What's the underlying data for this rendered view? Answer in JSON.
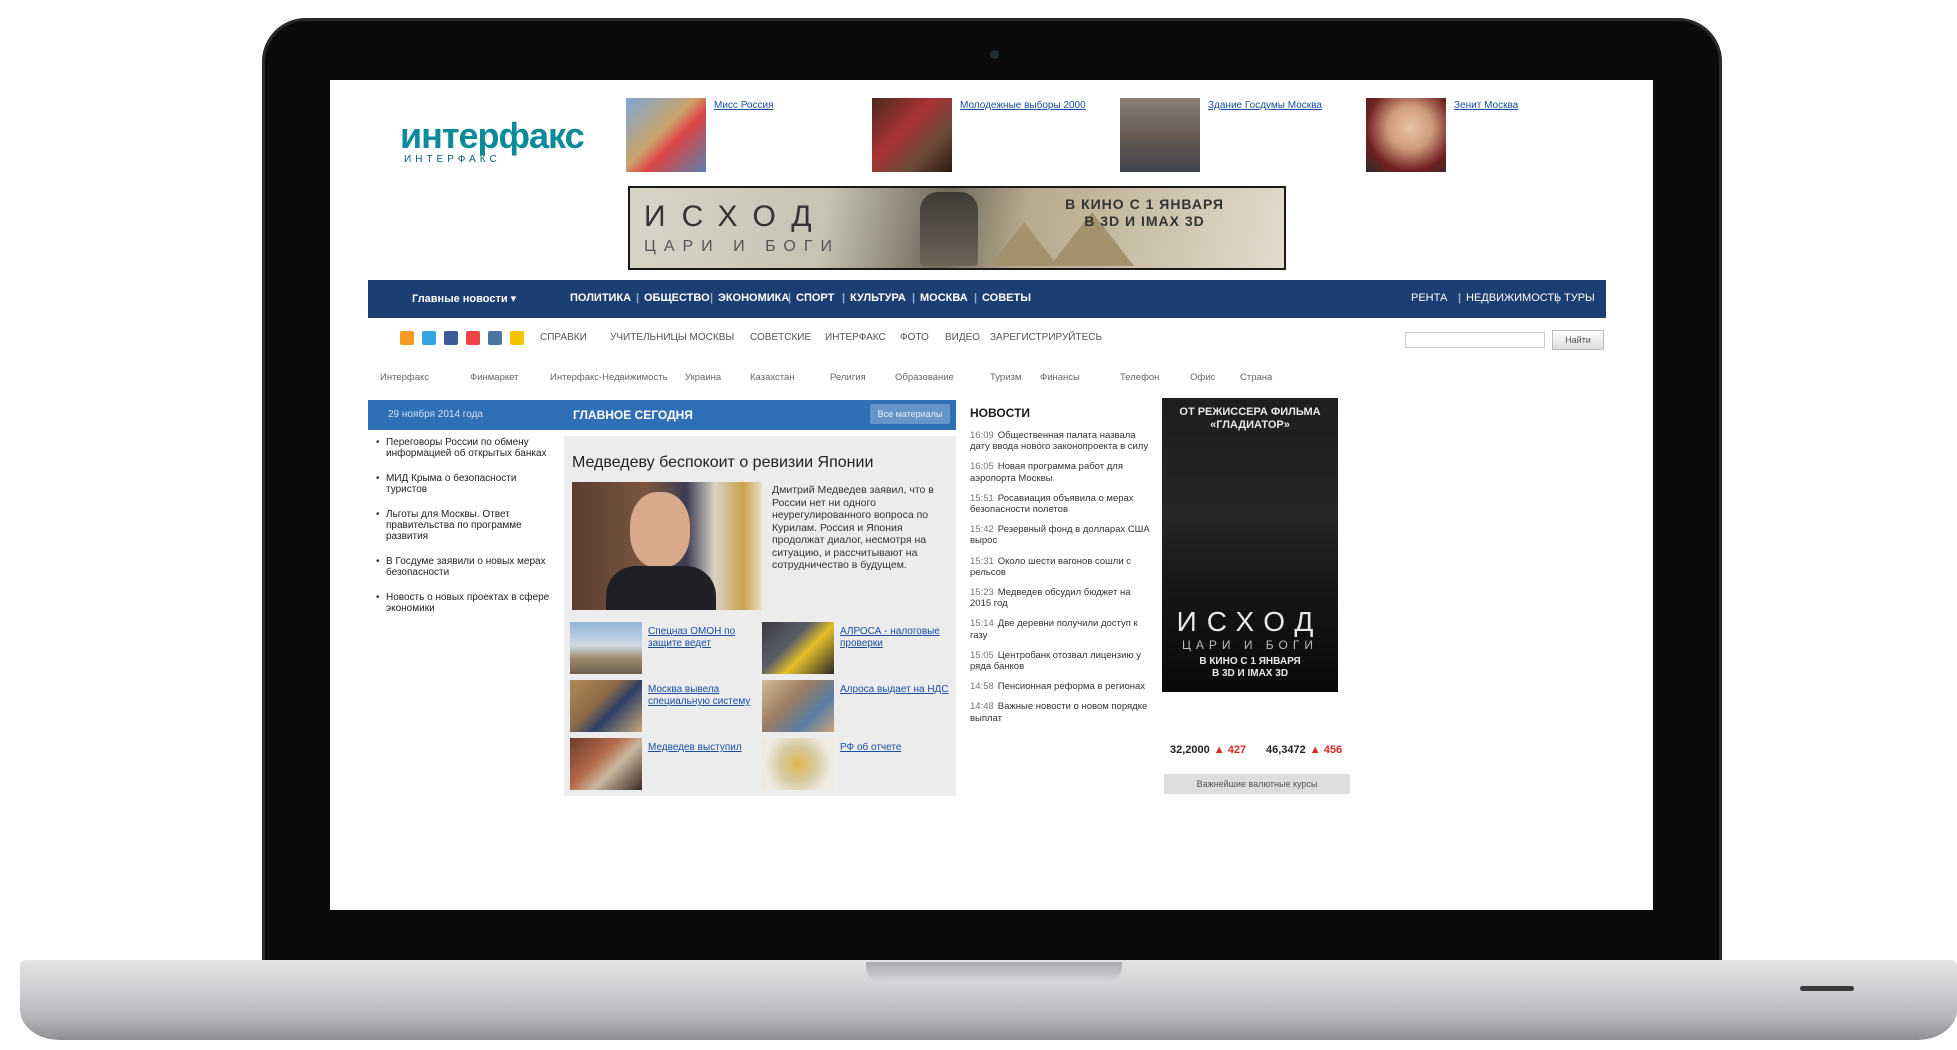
{
  "site": {
    "logo": "интерфакс",
    "logo_sub": "ИНТЕРФАКС"
  },
  "top_stories": [
    {
      "link": "Мисс Россия"
    },
    {
      "link": "Молодежные выборы 2000"
    },
    {
      "link": "Здание Госдумы Москва"
    },
    {
      "link": "Зенит Москва"
    }
  ],
  "banner": {
    "title": "ИСХОД",
    "subtitle": "ЦАРИ И БОГИ",
    "date": "В КИНО С 1 ЯНВАРЯ",
    "format": "В 3D И IMAX 3D"
  },
  "main_nav": {
    "regions": "Главные новости ▾",
    "items": [
      "ПОЛИТИКА",
      "ОБЩЕСТВО",
      "ЭКОНОМИКА",
      "СПОРТ",
      "КУЛЬТУРА",
      "МОСКВА",
      "СОВЕТЫ"
    ],
    "right": [
      "РЕНТА",
      "НЕДВИЖИМОСТЬ",
      "ТУРЫ"
    ]
  },
  "social_row": {
    "links": [
      "СПРАВКИ",
      "УЧИТЕЛЬНИЦЫ МОСКВЫ",
      "СОВЕТСКИЕ",
      "ИНТЕРФАКС",
      "ФОТО",
      "ВИДЕО",
      "ЗАРЕГИСТРИРУЙТЕСЬ"
    ],
    "search_button": "Найти"
  },
  "sites_row": {
    "items": [
      "Интерфакс",
      "Финмаркет",
      "Интерфакс-Недвижимость",
      "Украина",
      "Казахстан",
      "Религия",
      "Образование",
      "Туризм",
      "Финансы",
      "Телефон",
      "Офис",
      "Страна"
    ]
  },
  "date_bar": {
    "date": "29 ноября 2014 года",
    "title": "ГЛАВНОЕ СЕГОДНЯ",
    "all_news": "Все материалы"
  },
  "left_news": [
    "Переговоры России по обмену информацией об открытых банках",
    "МИД Крыма о безопасности туристов",
    "Льготы для Москвы. Ответ правительства по программе развития",
    "В Госдуме заявили о новых мерах безопасности",
    "Новость о новых проектах в сфере экономики"
  ],
  "main_story": {
    "title": "Медведеву беспокоит о ревизии Японии",
    "text": "Дмитрий Медведев заявил, что в России нет ни одного неурегулированного вопроса по Курилам. Россия и Япония продолжат диалог, несмотря на ситуацию, и рассчитывают на сотрудничество в будущем."
  },
  "sub_stories": [
    "Спецназ ОМОН по защите ведет",
    "АЛРОСА - налоговые проверки",
    "Москва вывела специальную систему",
    "Алроса выдает на НДС",
    "Медведев выступил",
    "РФ об отчете"
  ],
  "news": {
    "head": "НОВОСТИ",
    "items": [
      {
        "time": "16:09",
        "text": "Общественная палата назвала дату ввода нового законопроекта в силу"
      },
      {
        "time": "16:05",
        "text": "Новая программа работ для аэропорта Москвы"
      },
      {
        "time": "15:51",
        "text": "Росавиация объявила о мерах безопасности полетов"
      },
      {
        "time": "15:42",
        "text": "Резервный фонд в долларах США вырос"
      },
      {
        "time": "15:31",
        "text": "Около шести вагонов сошли с рельсов"
      },
      {
        "time": "15:23",
        "text": "Медведев обсудил бюджет на 2015 год"
      },
      {
        "time": "15:14",
        "text": "Две деревни получили доступ к газу"
      },
      {
        "time": "15:05",
        "text": "Центробанк отозвал лицензию у ряда банков"
      },
      {
        "time": "14:58",
        "text": "Пенсионная реформа в регионах"
      },
      {
        "time": "14:48",
        "text": "Важные новости о новом порядке выплат"
      }
    ]
  },
  "right_ad": {
    "top": "ОТ РЕЖИССЕРА ФИЛЬМА «ГЛАДИАТОР»",
    "title": "ИСХОД",
    "subtitle": "ЦАРИ И БОГИ",
    "date": "В КИНО С 1 ЯНВАРЯ",
    "format": "В 3D И IMAX 3D"
  },
  "ticker": [
    {
      "value": "32,2000",
      "change": "▲ 427"
    },
    {
      "value": "46,3472",
      "change": "▲ 456"
    }
  ],
  "gray_bar": "Важнейшие валютные курсы"
}
